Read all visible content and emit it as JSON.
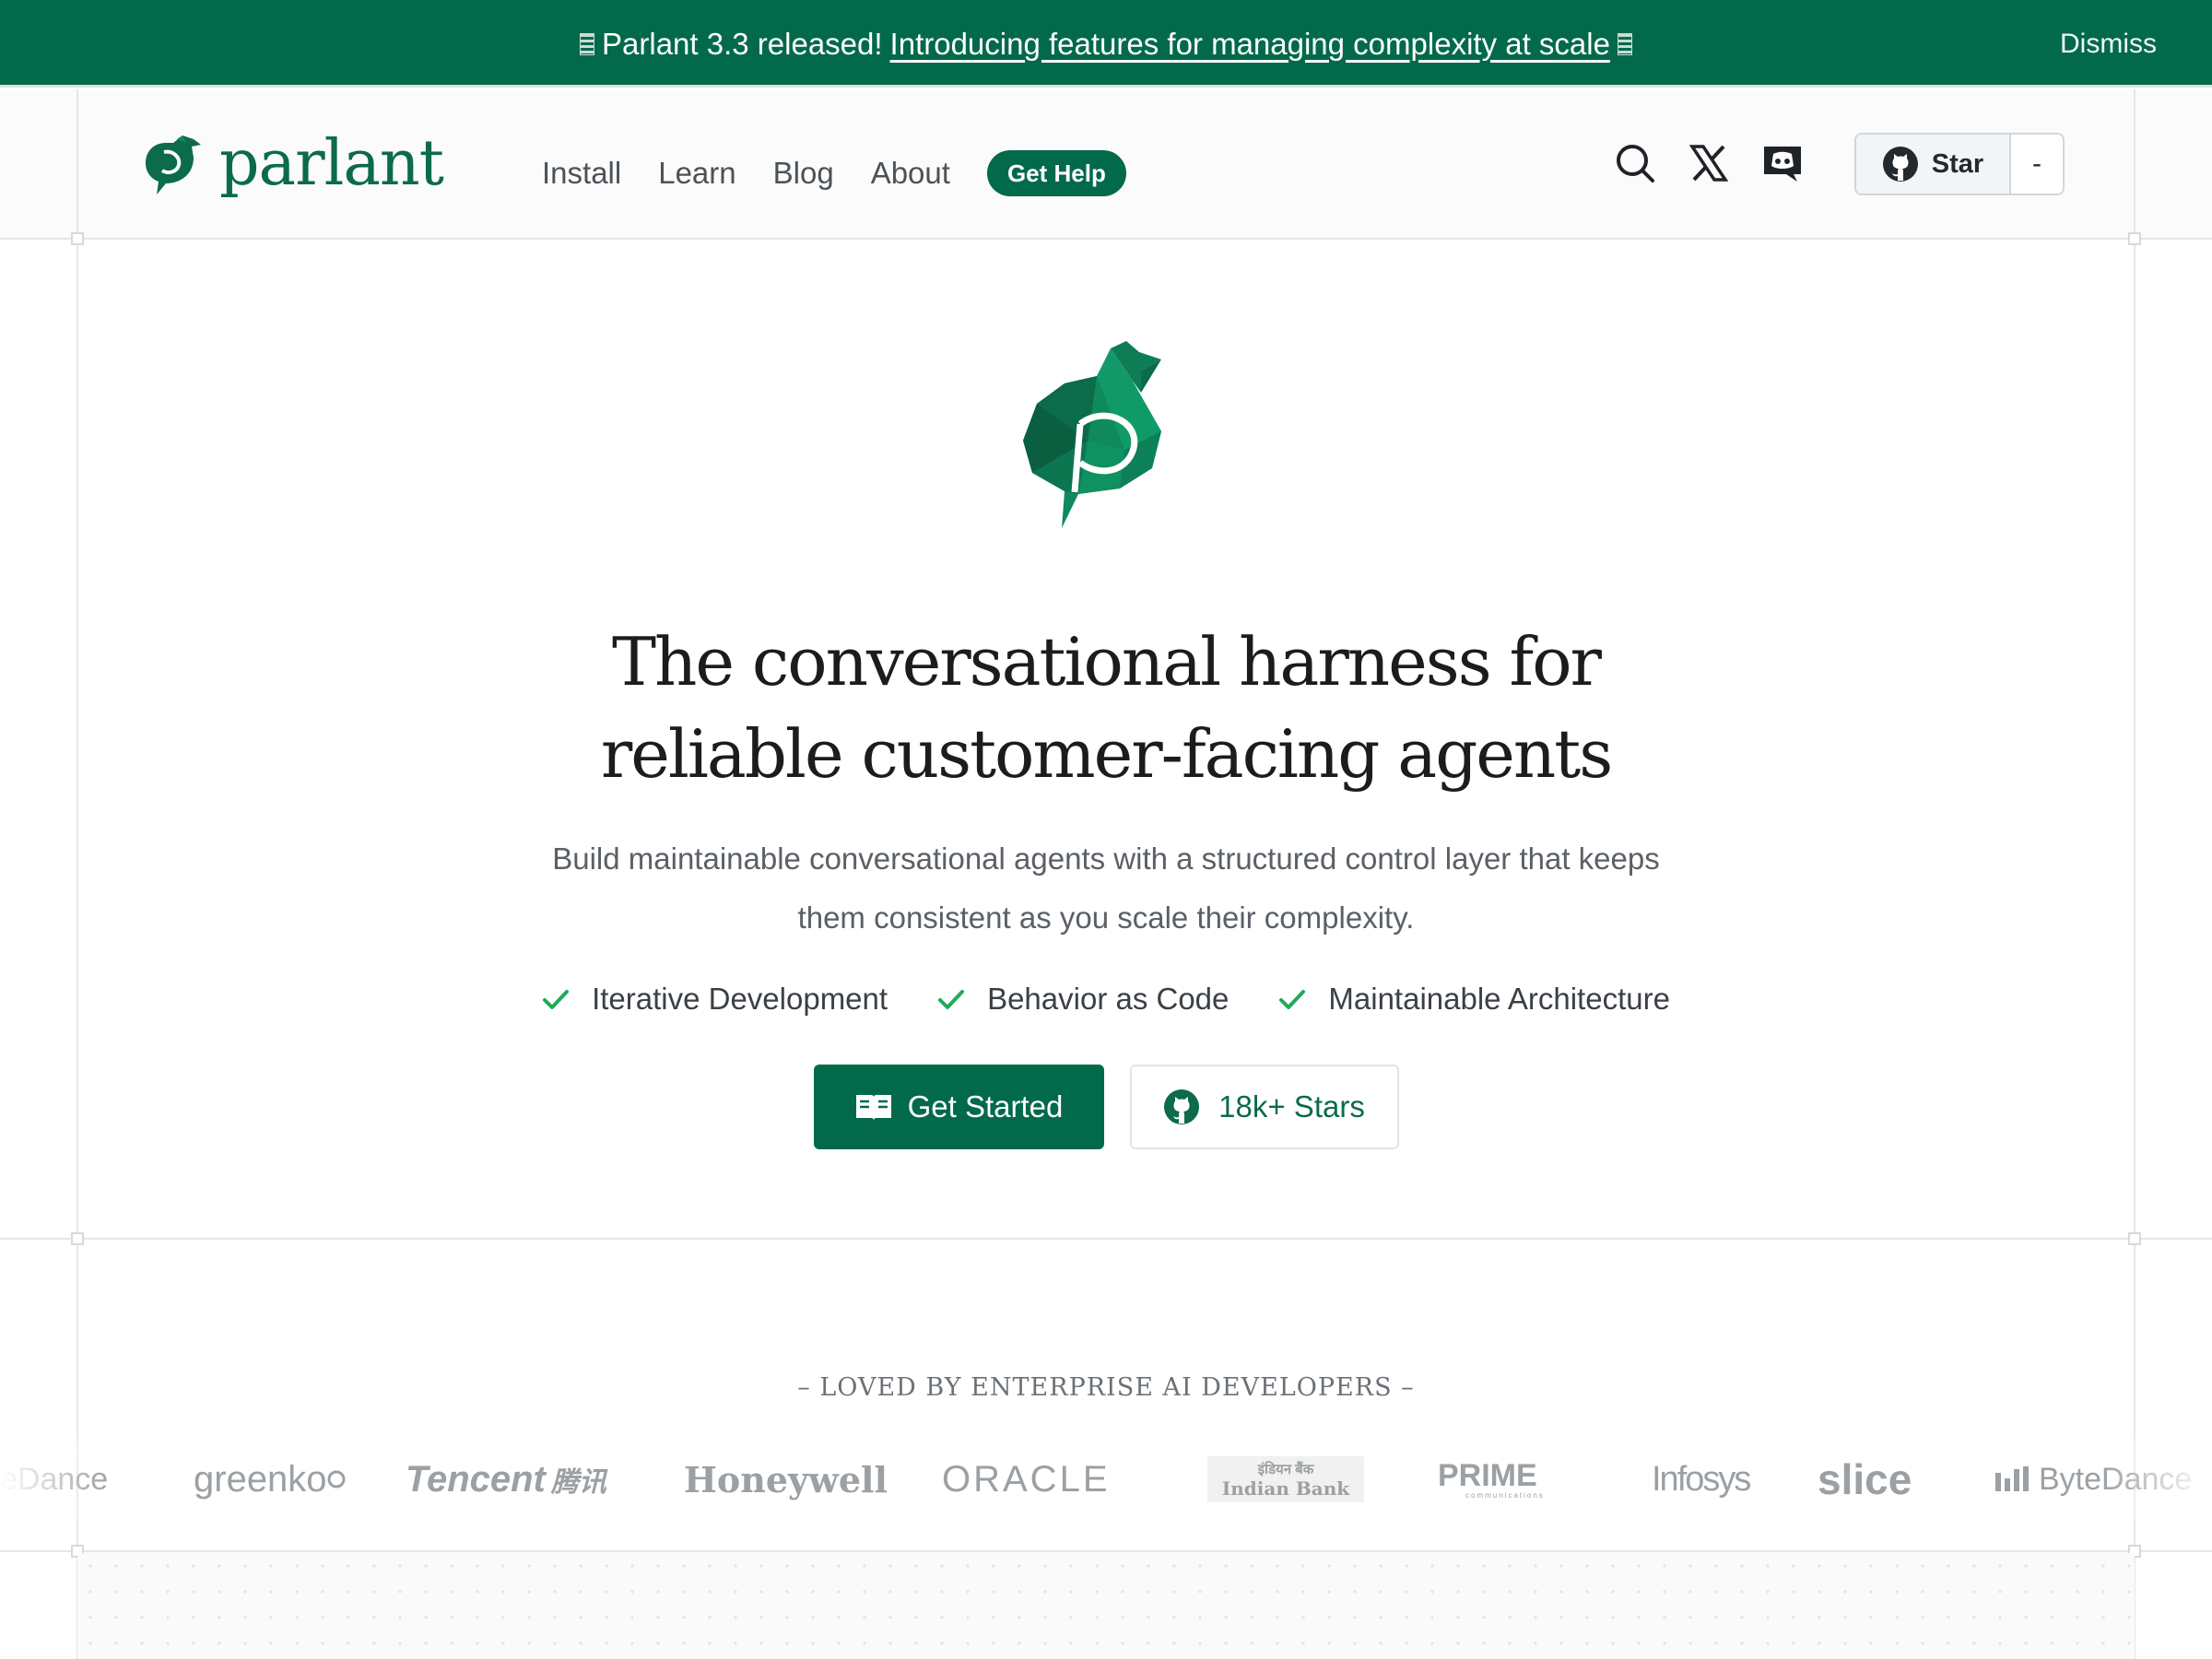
{
  "banner": {
    "prefix": "Parlant 3.3 released!",
    "link": "Introducing features for managing complexity at scale",
    "dismiss": "Dismiss"
  },
  "header": {
    "brand": "parlant",
    "nav": [
      "Install",
      "Learn",
      "Blog",
      "About"
    ],
    "help": "Get Help",
    "star_label": "Star",
    "star_count": "-"
  },
  "hero": {
    "title_line1": "The conversational harness for",
    "title_line2": "reliable customer-facing agents",
    "subtitle_line1": "Build maintainable conversational agents with a structured control layer that keeps",
    "subtitle_line2": "them consistent as you scale their complexity.",
    "features": [
      "Iterative Development",
      "Behavior as Code",
      "Maintainable Architecture"
    ],
    "cta_primary": "Get Started",
    "cta_secondary": "18k+ Stars"
  },
  "loved": "– LOVED BY ENTERPRISE AI DEVELOPERS –",
  "logos": [
    "eDance",
    "greenko",
    "Tencent",
    "腾讯",
    "Honeywell",
    "ORACLE",
    "इंडियन बैंक",
    "Indian Bank",
    "PRIME",
    "communications",
    "Infosys",
    "slice",
    "ByteDance"
  ],
  "colors": {
    "brand": "#026a4a",
    "check": "#1faa5a"
  }
}
